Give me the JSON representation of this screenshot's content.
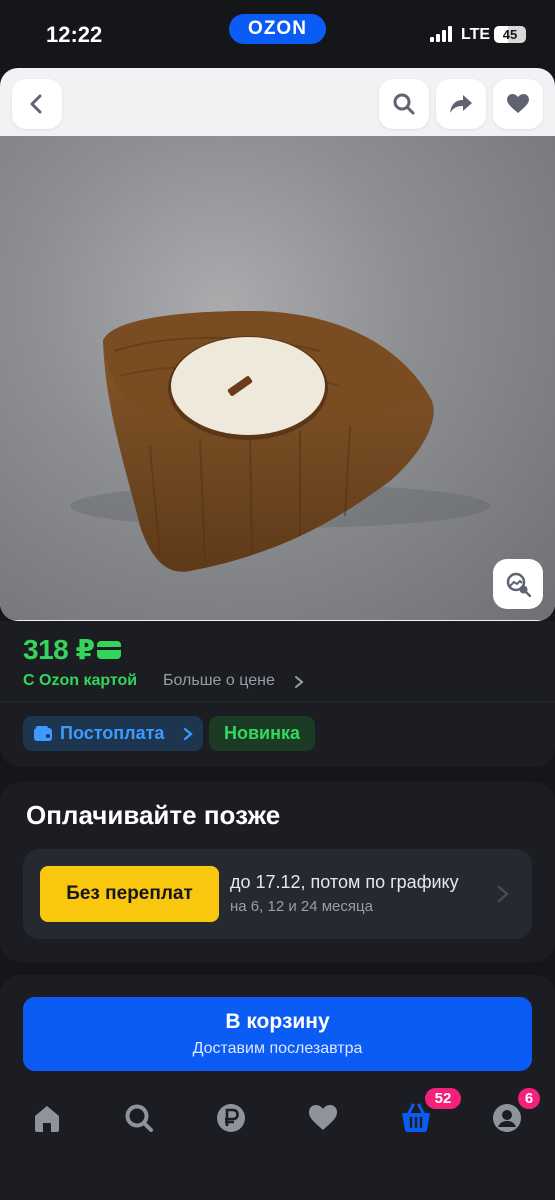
{
  "status_bar": {
    "time": "12:22",
    "logo": "OZON",
    "network": "LTE",
    "battery": "45",
    "battery_level": 0.45
  },
  "toolbar": {
    "back_icon": "chevron-left-icon",
    "search_icon": "search-icon",
    "share_icon": "share-arrow-icon",
    "favorite_icon": "heart-icon"
  },
  "product": {
    "image_desc_icon": "image-search-icon"
  },
  "price": {
    "value": "318 ₽",
    "card_label": "С Ozon картой",
    "more_label": "Больше о цене"
  },
  "badges": {
    "postpay": "Постоплата",
    "new": "Новинка"
  },
  "pay_later": {
    "title": "Оплачивайте позже",
    "no_overpay": "Без переплат",
    "line1": "до 17.12, потом по графику",
    "line2": "на 6, 12 и 24 месяца"
  },
  "cart": {
    "label": "В корзину",
    "sublabel": "Доставим послезавтра"
  },
  "nav": {
    "cart_count": "52",
    "profile_count": "6"
  },
  "colors": {
    "brand_blue": "#0a5cf5",
    "price_green": "#33d65a",
    "badge_pink": "#f4207b",
    "yellow": "#f9c80e"
  }
}
